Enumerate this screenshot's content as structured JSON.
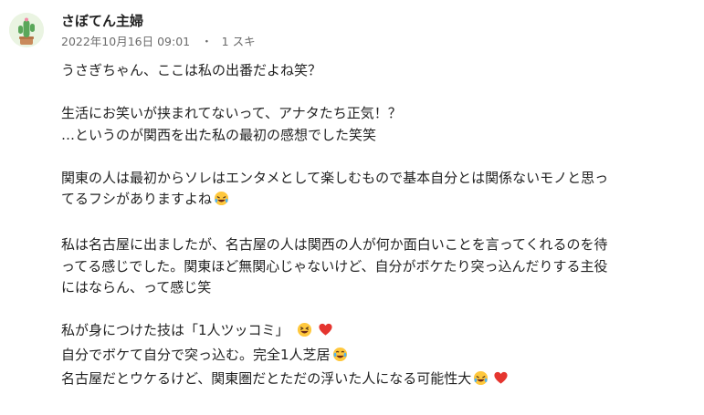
{
  "comment": {
    "author": "さぼてん主婦",
    "date": "2022年10月16日 09:01",
    "separator": "・",
    "likes": "1 スキ",
    "paragraphs": [
      [
        "うさぎちゃん、ここは私の出番だよね笑？"
      ],
      [
        "生活にお笑いが挟まれてないって、アナタたち正気！？",
        "…というのが関西を出た私の最初の感想でした笑笑"
      ],
      [
        "関東の人は最初からソレはエンタメとして楽しむもので基本自分とは関係ないモノと思っ",
        "てるフシがありますよね"
      ],
      [
        "私は名古屋に出ましたが、名古屋の人は関西の人が何か面白いことを言ってくれるのを待",
        "ってる感じでした。関東ほど無関心じゃないけど、自分がボケたり突っ込んだりする主役",
        "にはならん、って感じ笑"
      ],
      [
        "私が身につけた技は「1人ツッコミ」",
        "自分でボケて自分で突っ込む。完全1人芝居",
        "名古屋だとウケるけど、関東圏だとただの浮いた人になる可能性大"
      ]
    ]
  }
}
